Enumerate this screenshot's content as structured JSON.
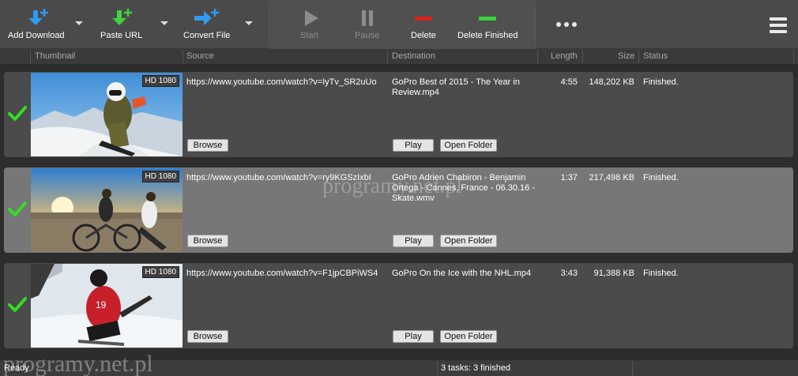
{
  "toolbar": {
    "add_download": "Add Download",
    "paste_url": "Paste URL",
    "convert_file": "Convert File",
    "start": "Start",
    "pause": "Pause",
    "delete": "Delete",
    "delete_finished": "Delete Finished",
    "more": "•••"
  },
  "columns": {
    "thumbnail": "Thumbnail",
    "source": "Source",
    "destination": "Destination",
    "length": "Length",
    "size": "Size",
    "status": "Status"
  },
  "rows": [
    {
      "badge": "HD 1080",
      "source": "https://www.youtube.com/watch?v=IyTv_SR2uUo",
      "destination": "GoPro  Best of 2015 - The Year in Review.mp4",
      "length": "4:55",
      "size": "148,202 KB",
      "status": "Finished.",
      "browse": "Browse",
      "play": "Play",
      "open_folder": "Open Folder"
    },
    {
      "badge": "HD 1080",
      "source": "https://www.youtube.com/watch?v=ry9KGSzIxbI",
      "destination": "GoPro  Adrien Chabiron - Benjamin Ortega - Cannes, France - 06.30.16 - Skate.wmv",
      "length": "1:37",
      "size": "217,498 KB",
      "status": "Finished.",
      "browse": "Browse",
      "play": "Play",
      "open_folder": "Open Folder"
    },
    {
      "badge": "HD 1080",
      "source": "https://www.youtube.com/watch?v=F1jpCBPiWS4",
      "destination": "GoPro  On the Ice with the NHL.mp4",
      "length": "3:43",
      "size": "91,388 KB",
      "status": "Finished.",
      "browse": "Browse",
      "play": "Play",
      "open_folder": "Open Folder"
    }
  ],
  "statusbar": {
    "left": "Ready",
    "center": "3 tasks: 3 finished"
  },
  "watermark": "programy.net.pl",
  "colors": {
    "accent_blue": "#2f9bf0",
    "accent_green": "#3fd33f",
    "delete_red": "#e02020",
    "check_green": "#33dd22"
  }
}
